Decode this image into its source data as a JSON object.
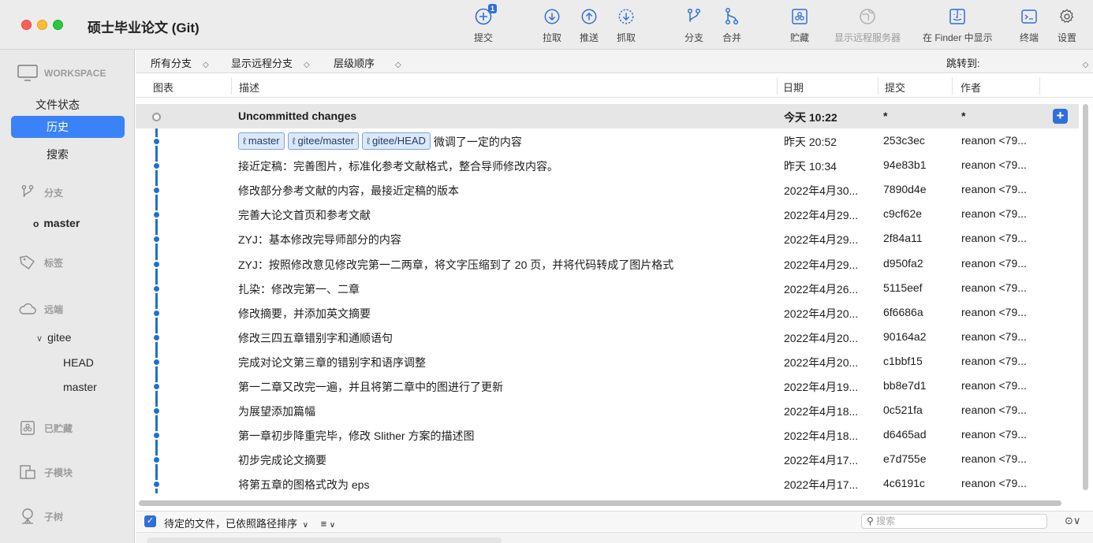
{
  "window": {
    "title": "硕士毕业论文 (Git)"
  },
  "toolbar": {
    "commit": {
      "label": "提交",
      "badge": "1",
      "icon": "plus-circle-icon"
    },
    "pull": {
      "label": "拉取",
      "icon": "arrow-down-circle-icon"
    },
    "push": {
      "label": "推送",
      "icon": "arrow-up-circle-icon"
    },
    "fetch": {
      "label": "抓取",
      "icon": "dashed-arrow-down-circle-icon"
    },
    "branch": {
      "label": "分支",
      "icon": "branch-icon"
    },
    "merge": {
      "label": "合并",
      "icon": "merge-icon"
    },
    "stash": {
      "label": "贮藏",
      "icon": "stash-box-icon"
    },
    "show_remote": {
      "label": "显示远程服务器",
      "icon": "globe-icon"
    },
    "finder": {
      "label": "在 Finder 中显示",
      "icon": "finder-icon"
    },
    "terminal": {
      "label": "终端",
      "icon": "terminal-icon"
    },
    "settings": {
      "label": "设置",
      "icon": "gear-icon"
    }
  },
  "sidebar": {
    "workspace": "WORKSPACE",
    "file_status": "文件状态",
    "history": "历史",
    "search": "搜索",
    "branches": "分支",
    "current_branch": "master",
    "tags": "标签",
    "remotes": "远端",
    "remote_name": "gitee",
    "remote_head": "HEAD",
    "remote_master": "master",
    "stashed": "已贮藏",
    "submodules": "子模块",
    "subtrees": "子树"
  },
  "filterbar": {
    "all_branches": "所有分支",
    "show_remote_branches": "显示远程分支",
    "order": "层级顺序",
    "jump_to": "跳转到:"
  },
  "columns": {
    "graph": "图表",
    "description": "描述",
    "date": "日期",
    "commit": "提交",
    "author": "作者"
  },
  "commits": [
    {
      "description": "Uncommitted changes",
      "date": "今天 10:22",
      "hash": "*",
      "author": "*",
      "refs": []
    },
    {
      "description": "微调了一定的内容",
      "date": "昨天 20:52",
      "hash": "253c3ec",
      "author": "reanon <79...",
      "refs": [
        "master",
        "gitee/master",
        "gitee/HEAD"
      ]
    },
    {
      "description": "接近定稿：完善图片，标准化参考文献格式，整合导师修改内容。",
      "date": "昨天 10:34",
      "hash": "94e83b1",
      "author": "reanon <79...",
      "refs": []
    },
    {
      "description": "修改部分参考文献的内容，最接近定稿的版本",
      "date": "2022年4月30...",
      "hash": "7890d4e",
      "author": "reanon <79...",
      "refs": []
    },
    {
      "description": "完善大论文首页和参考文献",
      "date": "2022年4月29...",
      "hash": "c9cf62e",
      "author": "reanon <79...",
      "refs": []
    },
    {
      "description": "ZYJ：基本修改完导师部分的内容",
      "date": "2022年4月29...",
      "hash": "2f84a11",
      "author": "reanon <79...",
      "refs": []
    },
    {
      "description": "ZYJ：按照修改意见修改完第一二两章，将文字压缩到了 20 页，并将代码转成了图片格式",
      "date": "2022年4月29...",
      "hash": "d950fa2",
      "author": "reanon <79...",
      "refs": []
    },
    {
      "description": "扎染：修改完第一、二章",
      "date": "2022年4月26...",
      "hash": "5115eef",
      "author": "reanon <79...",
      "refs": []
    },
    {
      "description": "修改摘要，并添加英文摘要",
      "date": "2022年4月20...",
      "hash": "6f6686a",
      "author": "reanon <79...",
      "refs": []
    },
    {
      "description": "修改三四五章错别字和通顺语句",
      "date": "2022年4月20...",
      "hash": "90164a2",
      "author": "reanon <79...",
      "refs": []
    },
    {
      "description": "完成对论文第三章的错别字和语序调整",
      "date": "2022年4月20...",
      "hash": "c1bbf15",
      "author": "reanon <79...",
      "refs": []
    },
    {
      "description": "第一二章又改完一遍，并且将第二章中的图进行了更新",
      "date": "2022年4月19...",
      "hash": "bb8e7d1",
      "author": "reanon <79...",
      "refs": []
    },
    {
      "description": "为展望添加篇幅",
      "date": "2022年4月18...",
      "hash": "0c521fa",
      "author": "reanon <79...",
      "refs": []
    },
    {
      "description": "第一章初步降重完毕，修改 Slither 方案的描述图",
      "date": "2022年4月18...",
      "hash": "d6465ad",
      "author": "reanon <79...",
      "refs": []
    },
    {
      "description": "初步完成论文摘要",
      "date": "2022年4月17...",
      "hash": "e7d755e",
      "author": "reanon <79...",
      "refs": []
    },
    {
      "description": "将第五章的图格式改为 eps",
      "date": "2022年4月17...",
      "hash": "4c6191c",
      "author": "reanon <79...",
      "refs": []
    }
  ],
  "bottom": {
    "pending_files": "待定的文件，已依照路径排序",
    "search_placeholder": "搜索"
  },
  "colors": {
    "accent": "#3a82f7",
    "graph": "#1f6fd1"
  }
}
